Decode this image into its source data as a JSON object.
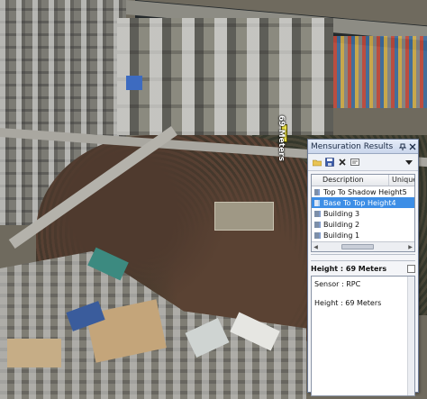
{
  "map": {
    "road_label": "69 Meters"
  },
  "window": {
    "title": "Mensuration Results",
    "buttons": {
      "pin_icon": "pin-icon",
      "close_icon": "close-icon"
    },
    "toolbar": {
      "tools": [
        "open-folder-icon",
        "save-icon",
        "delete-icon",
        "properties-icon",
        "dropdown-arrow-icon"
      ]
    },
    "table": {
      "columns": [
        "Description",
        "Unique"
      ],
      "rows": [
        {
          "label": "Top To Shadow Height5",
          "selected": false
        },
        {
          "label": "Base To Top Height4",
          "selected": true
        },
        {
          "label": "Building 3",
          "selected": false
        },
        {
          "label": "Building 2",
          "selected": false
        },
        {
          "label": "Building 1",
          "selected": false
        }
      ]
    },
    "detail": {
      "heading": "Height : 69 Meters",
      "sensor": "Sensor : RPC",
      "height": "Height : 69 Meters"
    },
    "colors": {
      "selection": "#3d8ee6",
      "titlebar": "#c9d6ec"
    }
  }
}
